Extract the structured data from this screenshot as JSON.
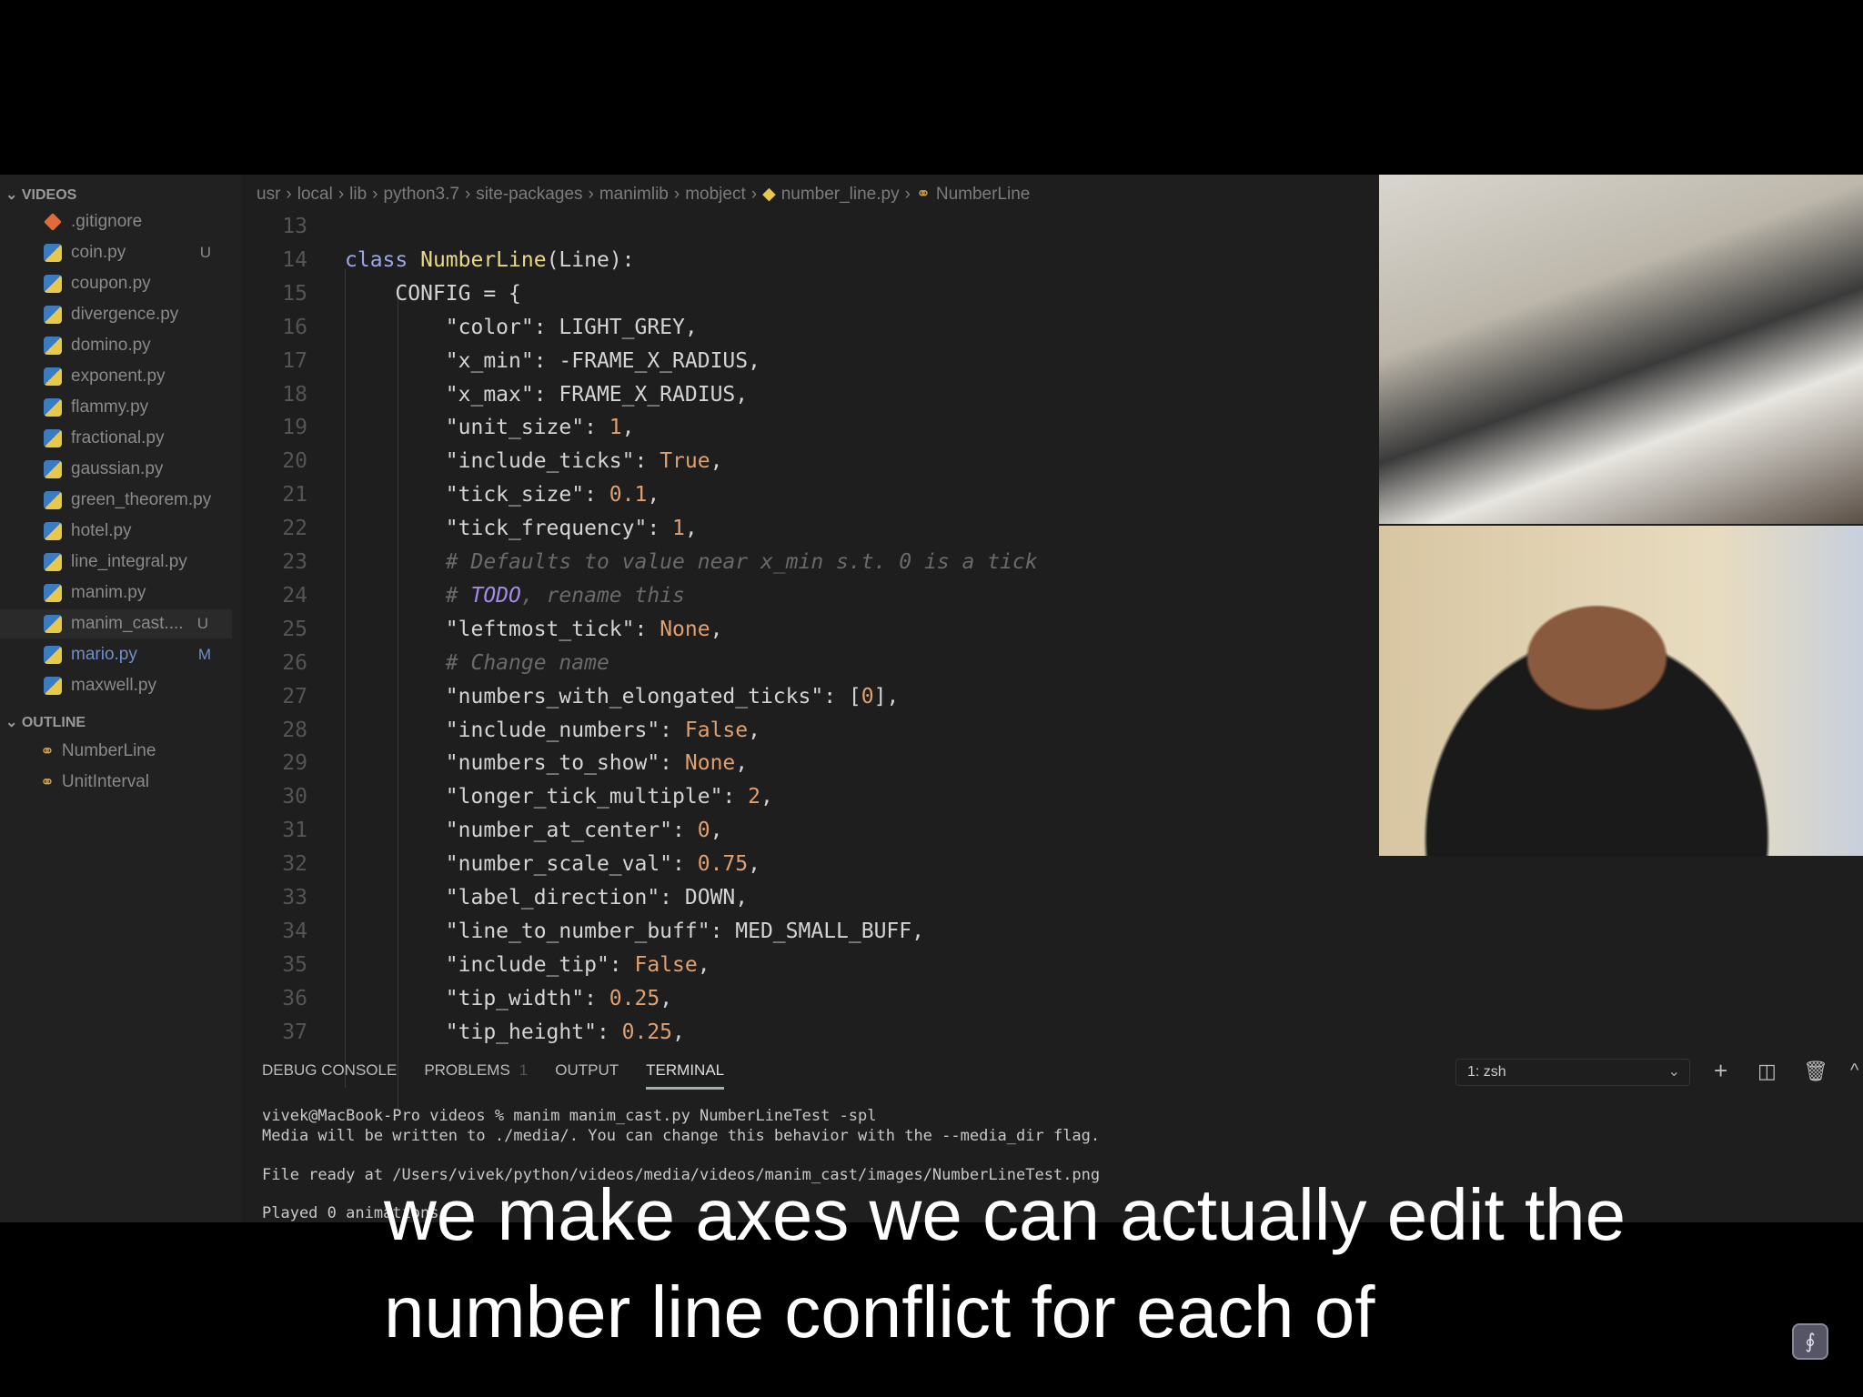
{
  "sidebar": {
    "section_videos": "VIDEOS",
    "files": [
      {
        "name": ".gitignore",
        "icon": "git-icon",
        "badge": ""
      },
      {
        "name": "coin.py",
        "icon": "python-icon",
        "badge": "U"
      },
      {
        "name": "coupon.py",
        "icon": "python-icon",
        "badge": ""
      },
      {
        "name": "divergence.py",
        "icon": "python-icon",
        "badge": ""
      },
      {
        "name": "domino.py",
        "icon": "python-icon",
        "badge": ""
      },
      {
        "name": "exponent.py",
        "icon": "python-icon",
        "badge": ""
      },
      {
        "name": "flammy.py",
        "icon": "python-icon",
        "badge": ""
      },
      {
        "name": "fractional.py",
        "icon": "python-icon",
        "badge": ""
      },
      {
        "name": "gaussian.py",
        "icon": "python-icon",
        "badge": ""
      },
      {
        "name": "green_theorem.py",
        "icon": "python-icon",
        "badge": ""
      },
      {
        "name": "hotel.py",
        "icon": "python-icon",
        "badge": ""
      },
      {
        "name": "line_integral.py",
        "icon": "python-icon",
        "badge": ""
      },
      {
        "name": "manim.py",
        "icon": "python-icon",
        "badge": ""
      },
      {
        "name": "manim_cast....",
        "icon": "python-icon",
        "badge": "U"
      },
      {
        "name": "mario.py",
        "icon": "python-icon",
        "badge": "M"
      },
      {
        "name": "maxwell.py",
        "icon": "python-icon",
        "badge": ""
      }
    ],
    "section_outline": "OUTLINE",
    "outline": [
      "NumberLine",
      "UnitInterval"
    ]
  },
  "breadcrumb": [
    "usr",
    "local",
    "lib",
    "python3.7",
    "site-packages",
    "manimlib",
    "mobject",
    "number_line.py",
    "NumberLine"
  ],
  "code": {
    "lines": [
      {
        "n": "13",
        "t": []
      },
      {
        "n": "14",
        "t": [
          [
            "kw",
            "class "
          ],
          [
            "cn",
            "NumberLine"
          ],
          [
            "st",
            "(Line):"
          ]
        ]
      },
      {
        "n": "15",
        "t": [
          [
            "st",
            "    CONFIG = {"
          ]
        ]
      },
      {
        "n": "16",
        "t": [
          [
            "st",
            "        \"color\": LIGHT_GREY,"
          ]
        ]
      },
      {
        "n": "17",
        "t": [
          [
            "st",
            "        \"x_min\": -FRAME_X_RADIUS,"
          ]
        ]
      },
      {
        "n": "18",
        "t": [
          [
            "st",
            "        \"x_max\": FRAME_X_RADIUS,"
          ]
        ]
      },
      {
        "n": "19",
        "t": [
          [
            "st",
            "        \"unit_size\": "
          ],
          [
            "nu",
            "1"
          ],
          [
            "st",
            ","
          ]
        ]
      },
      {
        "n": "20",
        "t": [
          [
            "st",
            "        \"include_ticks\": "
          ],
          [
            "bo",
            "True"
          ],
          [
            "st",
            ","
          ]
        ]
      },
      {
        "n": "21",
        "t": [
          [
            "st",
            "        \"tick_size\": "
          ],
          [
            "nu",
            "0.1"
          ],
          [
            "st",
            ","
          ]
        ]
      },
      {
        "n": "22",
        "t": [
          [
            "st",
            "        \"tick_frequency\": "
          ],
          [
            "nu",
            "1"
          ],
          [
            "st",
            ","
          ]
        ]
      },
      {
        "n": "23",
        "t": [
          [
            "co",
            "        # Defaults to value near x_min s.t. 0 is a tick"
          ]
        ]
      },
      {
        "n": "24",
        "t": [
          [
            "co",
            "        # "
          ],
          [
            "td",
            "TODO"
          ],
          [
            "co",
            ", rename this"
          ]
        ]
      },
      {
        "n": "25",
        "t": [
          [
            "st",
            "        \"leftmost_tick\": "
          ],
          [
            "bo",
            "None"
          ],
          [
            "st",
            ","
          ]
        ]
      },
      {
        "n": "26",
        "t": [
          [
            "co",
            "        # Change name"
          ]
        ]
      },
      {
        "n": "27",
        "t": [
          [
            "st",
            "        \"numbers_with_elongated_ticks\": ["
          ],
          [
            "nu",
            "0"
          ],
          [
            "st",
            "],"
          ]
        ]
      },
      {
        "n": "28",
        "t": [
          [
            "st",
            "        \"include_numbers\": "
          ],
          [
            "bo",
            "False"
          ],
          [
            "st",
            ","
          ]
        ]
      },
      {
        "n": "29",
        "t": [
          [
            "st",
            "        \"numbers_to_show\": "
          ],
          [
            "bo",
            "None"
          ],
          [
            "st",
            ","
          ]
        ]
      },
      {
        "n": "30",
        "t": [
          [
            "st",
            "        \"longer_tick_multiple\": "
          ],
          [
            "nu",
            "2"
          ],
          [
            "st",
            ","
          ]
        ]
      },
      {
        "n": "31",
        "t": [
          [
            "st",
            "        \"number_at_center\": "
          ],
          [
            "nu",
            "0"
          ],
          [
            "st",
            ","
          ]
        ]
      },
      {
        "n": "32",
        "t": [
          [
            "st",
            "        \"number_scale_val\": "
          ],
          [
            "nu",
            "0.75"
          ],
          [
            "st",
            ","
          ]
        ]
      },
      {
        "n": "33",
        "t": [
          [
            "st",
            "        \"label_direction\": DOWN,"
          ]
        ]
      },
      {
        "n": "34",
        "t": [
          [
            "st",
            "        \"line_to_number_buff\": MED_SMALL_BUFF,"
          ]
        ]
      },
      {
        "n": "35",
        "t": [
          [
            "st",
            "        \"include_tip\": "
          ],
          [
            "bo",
            "False"
          ],
          [
            "st",
            ","
          ]
        ]
      },
      {
        "n": "36",
        "t": [
          [
            "st",
            "        \"tip_width\": "
          ],
          [
            "nu",
            "0.25"
          ],
          [
            "st",
            ","
          ]
        ]
      },
      {
        "n": "37",
        "t": [
          [
            "st",
            "        \"tip_height\": "
          ],
          [
            "nu",
            "0.25"
          ],
          [
            "st",
            ","
          ]
        ]
      }
    ]
  },
  "panel": {
    "tabs": [
      "DEBUG CONSOLE",
      "PROBLEMS",
      "OUTPUT",
      "TERMINAL"
    ],
    "problems_count": "1",
    "active_tab": "TERMINAL",
    "shell": "1: zsh",
    "terminal": [
      "vivek@MacBook-Pro videos % manim manim_cast.py NumberLineTest -spl",
      "Media will be written to ./media/. You can change this behavior with the --media_dir flag.",
      "File ready at /Users/vivek/python/videos/media/videos/manim_cast/images/NumberLineTest.png",
      "Played 0 animations"
    ]
  },
  "subtitles": [
    "we make axes we can actually edit the",
    "number line conflict for each of"
  ]
}
